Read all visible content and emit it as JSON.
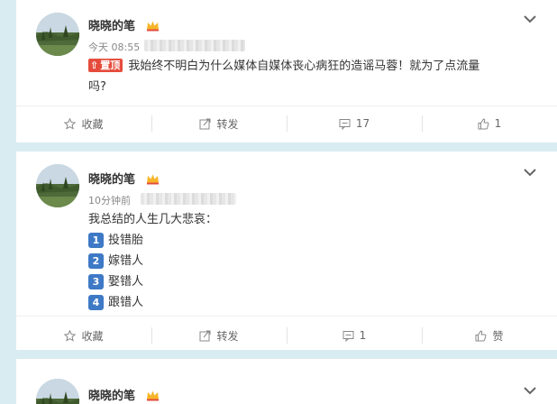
{
  "posts": [
    {
      "author": "晓晓的笔",
      "time": "今天 08:55",
      "pinned_label": "置顶",
      "text_line1": "我始终不明白为什么媒体自媒体丧心病狂的造谣马蓉！就为了点流量",
      "text_line2": "吗?",
      "actions": {
        "favorite": "收藏",
        "repost": "转发",
        "comment": "17",
        "like": "1"
      }
    },
    {
      "author": "晓晓的笔",
      "time": "10分钟前",
      "intro": "我总结的人生几大悲哀：",
      "items": [
        {
          "num": "1",
          "text": "投错胎"
        },
        {
          "num": "2",
          "text": "嫁错人"
        },
        {
          "num": "3",
          "text": "娶错人"
        },
        {
          "num": "4",
          "text": "跟错人"
        }
      ],
      "actions": {
        "favorite": "收藏",
        "repost": "转发",
        "comment": "1",
        "like": "赞"
      }
    },
    {
      "author": "晓晓的笔"
    }
  ],
  "icons": {
    "favorite": "star-icon",
    "repost": "repost-icon",
    "comment": "comment-icon",
    "like": "thumbs-up-icon",
    "menu": "chevron-down-icon",
    "badge": "crown-icon"
  },
  "colors": {
    "pinned": "#e54c3c",
    "number_badge": "#3e79c6",
    "feed_bg": "#d9ecf1"
  }
}
